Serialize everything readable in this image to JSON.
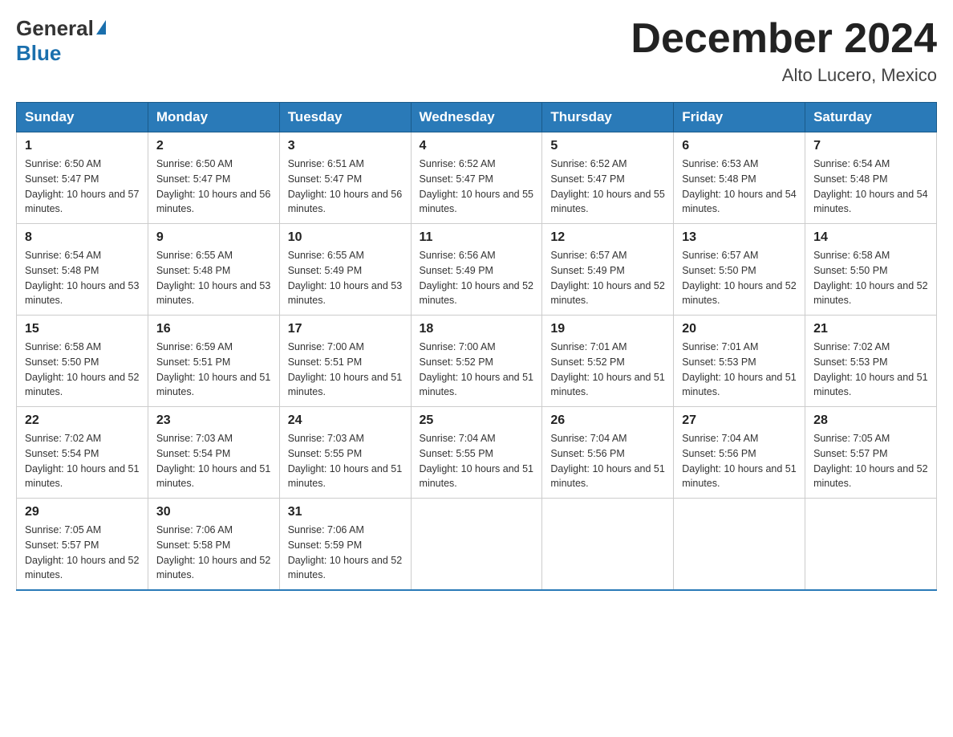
{
  "header": {
    "logo_general": "General",
    "logo_blue": "Blue",
    "title": "December 2024",
    "subtitle": "Alto Lucero, Mexico"
  },
  "days_header": [
    "Sunday",
    "Monday",
    "Tuesday",
    "Wednesday",
    "Thursday",
    "Friday",
    "Saturday"
  ],
  "weeks": [
    [
      {
        "num": "1",
        "sunrise": "6:50 AM",
        "sunset": "5:47 PM",
        "daylight": "10 hours and 57 minutes."
      },
      {
        "num": "2",
        "sunrise": "6:50 AM",
        "sunset": "5:47 PM",
        "daylight": "10 hours and 56 minutes."
      },
      {
        "num": "3",
        "sunrise": "6:51 AM",
        "sunset": "5:47 PM",
        "daylight": "10 hours and 56 minutes."
      },
      {
        "num": "4",
        "sunrise": "6:52 AM",
        "sunset": "5:47 PM",
        "daylight": "10 hours and 55 minutes."
      },
      {
        "num": "5",
        "sunrise": "6:52 AM",
        "sunset": "5:47 PM",
        "daylight": "10 hours and 55 minutes."
      },
      {
        "num": "6",
        "sunrise": "6:53 AM",
        "sunset": "5:48 PM",
        "daylight": "10 hours and 54 minutes."
      },
      {
        "num": "7",
        "sunrise": "6:54 AM",
        "sunset": "5:48 PM",
        "daylight": "10 hours and 54 minutes."
      }
    ],
    [
      {
        "num": "8",
        "sunrise": "6:54 AM",
        "sunset": "5:48 PM",
        "daylight": "10 hours and 53 minutes."
      },
      {
        "num": "9",
        "sunrise": "6:55 AM",
        "sunset": "5:48 PM",
        "daylight": "10 hours and 53 minutes."
      },
      {
        "num": "10",
        "sunrise": "6:55 AM",
        "sunset": "5:49 PM",
        "daylight": "10 hours and 53 minutes."
      },
      {
        "num": "11",
        "sunrise": "6:56 AM",
        "sunset": "5:49 PM",
        "daylight": "10 hours and 52 minutes."
      },
      {
        "num": "12",
        "sunrise": "6:57 AM",
        "sunset": "5:49 PM",
        "daylight": "10 hours and 52 minutes."
      },
      {
        "num": "13",
        "sunrise": "6:57 AM",
        "sunset": "5:50 PM",
        "daylight": "10 hours and 52 minutes."
      },
      {
        "num": "14",
        "sunrise": "6:58 AM",
        "sunset": "5:50 PM",
        "daylight": "10 hours and 52 minutes."
      }
    ],
    [
      {
        "num": "15",
        "sunrise": "6:58 AM",
        "sunset": "5:50 PM",
        "daylight": "10 hours and 52 minutes."
      },
      {
        "num": "16",
        "sunrise": "6:59 AM",
        "sunset": "5:51 PM",
        "daylight": "10 hours and 51 minutes."
      },
      {
        "num": "17",
        "sunrise": "7:00 AM",
        "sunset": "5:51 PM",
        "daylight": "10 hours and 51 minutes."
      },
      {
        "num": "18",
        "sunrise": "7:00 AM",
        "sunset": "5:52 PM",
        "daylight": "10 hours and 51 minutes."
      },
      {
        "num": "19",
        "sunrise": "7:01 AM",
        "sunset": "5:52 PM",
        "daylight": "10 hours and 51 minutes."
      },
      {
        "num": "20",
        "sunrise": "7:01 AM",
        "sunset": "5:53 PM",
        "daylight": "10 hours and 51 minutes."
      },
      {
        "num": "21",
        "sunrise": "7:02 AM",
        "sunset": "5:53 PM",
        "daylight": "10 hours and 51 minutes."
      }
    ],
    [
      {
        "num": "22",
        "sunrise": "7:02 AM",
        "sunset": "5:54 PM",
        "daylight": "10 hours and 51 minutes."
      },
      {
        "num": "23",
        "sunrise": "7:03 AM",
        "sunset": "5:54 PM",
        "daylight": "10 hours and 51 minutes."
      },
      {
        "num": "24",
        "sunrise": "7:03 AM",
        "sunset": "5:55 PM",
        "daylight": "10 hours and 51 minutes."
      },
      {
        "num": "25",
        "sunrise": "7:04 AM",
        "sunset": "5:55 PM",
        "daylight": "10 hours and 51 minutes."
      },
      {
        "num": "26",
        "sunrise": "7:04 AM",
        "sunset": "5:56 PM",
        "daylight": "10 hours and 51 minutes."
      },
      {
        "num": "27",
        "sunrise": "7:04 AM",
        "sunset": "5:56 PM",
        "daylight": "10 hours and 51 minutes."
      },
      {
        "num": "28",
        "sunrise": "7:05 AM",
        "sunset": "5:57 PM",
        "daylight": "10 hours and 52 minutes."
      }
    ],
    [
      {
        "num": "29",
        "sunrise": "7:05 AM",
        "sunset": "5:57 PM",
        "daylight": "10 hours and 52 minutes."
      },
      {
        "num": "30",
        "sunrise": "7:06 AM",
        "sunset": "5:58 PM",
        "daylight": "10 hours and 52 minutes."
      },
      {
        "num": "31",
        "sunrise": "7:06 AM",
        "sunset": "5:59 PM",
        "daylight": "10 hours and 52 minutes."
      },
      null,
      null,
      null,
      null
    ]
  ]
}
